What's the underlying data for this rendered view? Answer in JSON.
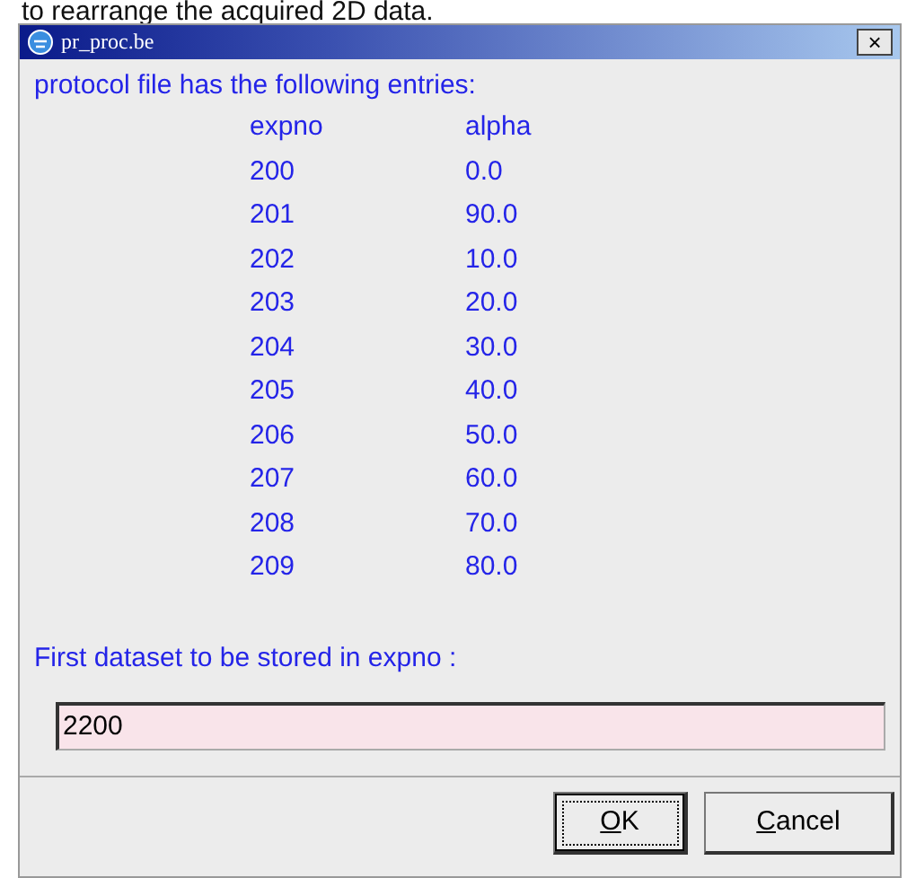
{
  "background_text": "to rearrange the acquired 2D data.",
  "window": {
    "title": "pr_proc.be",
    "close": "×"
  },
  "intro": "protocol file has the following entries:",
  "table": {
    "columns": [
      "expno",
      "alpha"
    ],
    "rows": [
      [
        "200",
        "0.0"
      ],
      [
        "201",
        "90.0"
      ],
      [
        "202",
        "10.0"
      ],
      [
        "203",
        "20.0"
      ],
      [
        "204",
        "30.0"
      ],
      [
        "205",
        "40.0"
      ],
      [
        "206",
        "50.0"
      ],
      [
        "207",
        "60.0"
      ],
      [
        "208",
        "70.0"
      ],
      [
        "209",
        "80.0"
      ]
    ]
  },
  "prompt": "First dataset to be stored in expno :",
  "field": {
    "value": "2200"
  },
  "buttons": [
    {
      "mnemonic": "O",
      "rest": "K",
      "focused": true
    },
    {
      "mnemonic": "C",
      "rest": "ancel",
      "focused": false
    }
  ]
}
